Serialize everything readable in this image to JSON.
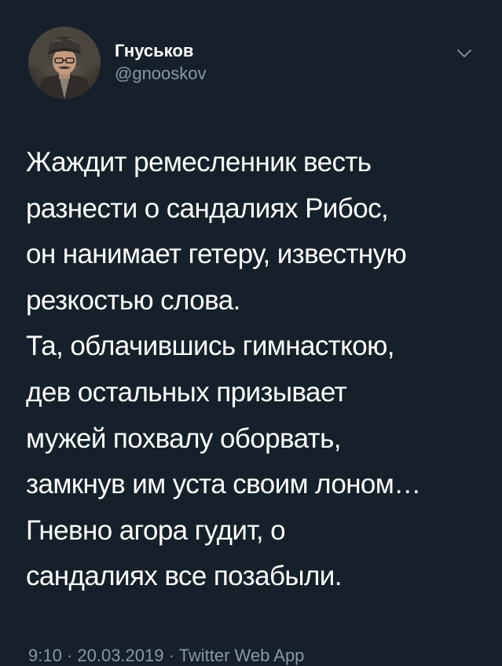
{
  "tweet": {
    "author": {
      "display_name": "Гнуськов",
      "handle": "@gnooskov"
    },
    "text": "Жаждит ремесленник весть\nразнести о сандалиях Рибос,\nон нанимает гетеру, известную\nрезкостью слова.\nТа, облачившись гимнасткою,\nдев остальных призывает\nмужей похвалу оборвать,\nзамкнув им уста своим лоном…\nГневно агора гудит, о\nсандалиях все позабыли.",
    "footer_partial": "9:10 · 20.03.2019 · Twitter Web App",
    "icons": {
      "menu": "chevron-down-icon",
      "avatar": "profile-photo"
    }
  },
  "colors": {
    "background": "#15202b",
    "text": "#ffffff",
    "secondary": "#8899a6"
  }
}
